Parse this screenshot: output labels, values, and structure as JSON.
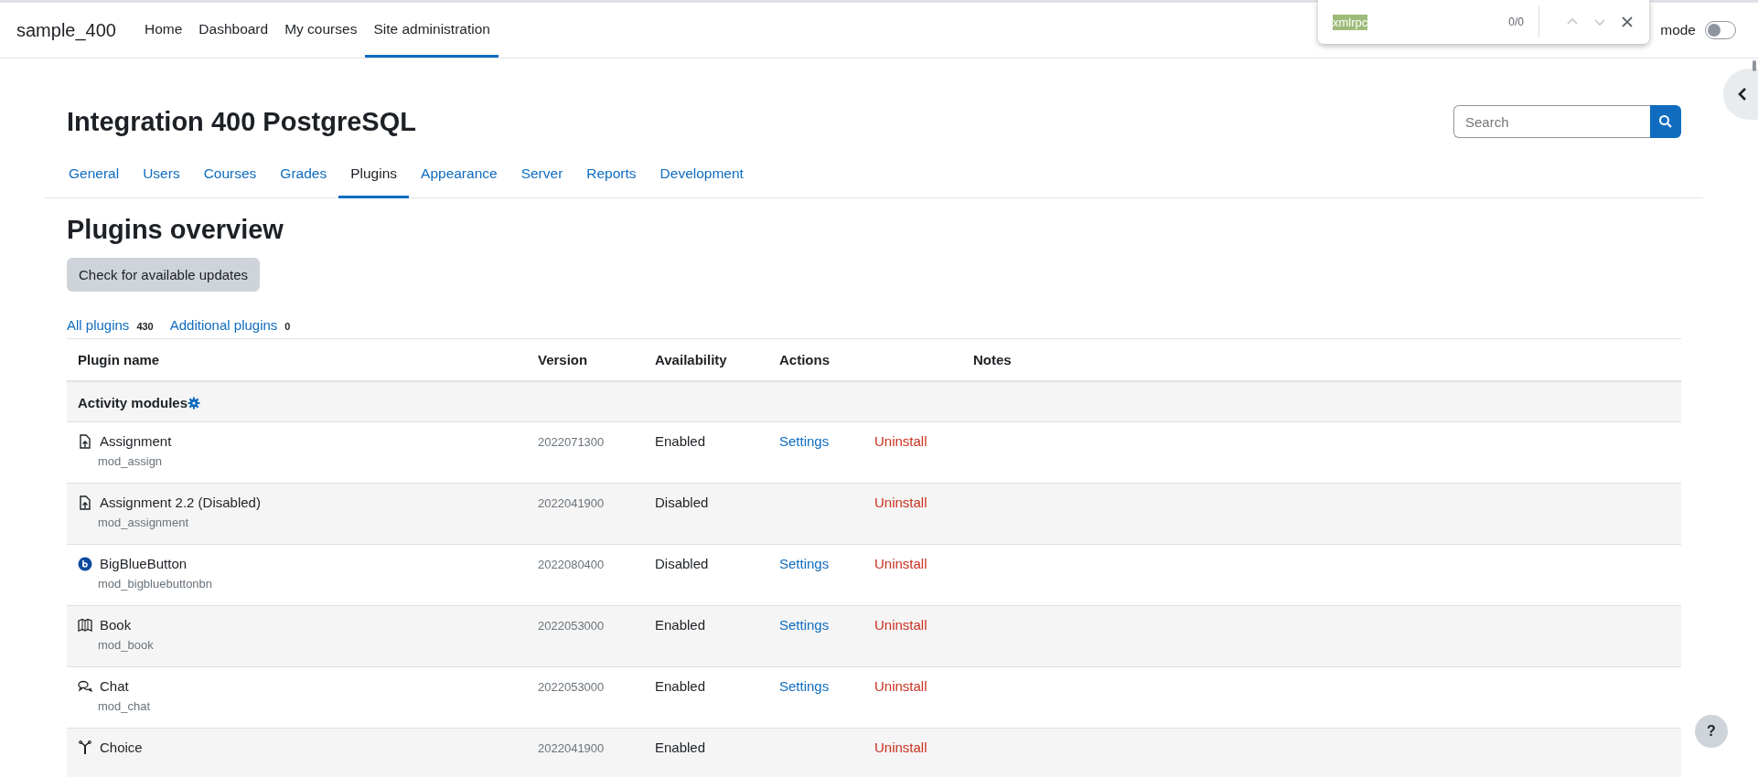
{
  "navbar": {
    "brand": "sample_400",
    "items": [
      {
        "label": "Home",
        "selected": false
      },
      {
        "label": "Dashboard",
        "selected": false
      },
      {
        "label": "My courses",
        "selected": false
      },
      {
        "label": "Site administration",
        "selected": true
      }
    ],
    "edit_mode": {
      "label": "mode",
      "on": false
    }
  },
  "find_bar": {
    "query": "xmlrpc",
    "count": "0/0"
  },
  "header": {
    "title": "Integration 400 PostgreSQL",
    "search": {
      "placeholder": "Search"
    }
  },
  "tabs": [
    {
      "label": "General",
      "selected": false
    },
    {
      "label": "Users",
      "selected": false
    },
    {
      "label": "Courses",
      "selected": false
    },
    {
      "label": "Grades",
      "selected": false
    },
    {
      "label": "Plugins",
      "selected": true
    },
    {
      "label": "Appearance",
      "selected": false
    },
    {
      "label": "Server",
      "selected": false
    },
    {
      "label": "Reports",
      "selected": false
    },
    {
      "label": "Development",
      "selected": false
    }
  ],
  "page_title": "Plugins overview",
  "update_button": "Check for available updates",
  "filters": [
    {
      "label": "All plugins",
      "count": "430"
    },
    {
      "label": "Additional plugins",
      "count": "0"
    }
  ],
  "table": {
    "columns": [
      "Plugin name",
      "Version",
      "Availability",
      "Actions",
      "Notes"
    ],
    "group": "Activity modules",
    "rows": [
      {
        "kind": "assign",
        "name": "Assignment",
        "component": "mod_assign",
        "version": "2022071300",
        "availability": "Enabled",
        "settings": "Settings",
        "uninstall": "Uninstall"
      },
      {
        "kind": "assign",
        "name": "Assignment 2.2 (Disabled)",
        "component": "mod_assignment",
        "version": "2022041900",
        "availability": "Disabled",
        "uninstall": "Uninstall"
      },
      {
        "kind": "bigbluebutton",
        "name": "BigBlueButton",
        "component": "mod_bigbluebuttonbn",
        "version": "2022080400",
        "availability": "Disabled",
        "settings": "Settings",
        "uninstall": "Uninstall"
      },
      {
        "kind": "book",
        "name": "Book",
        "component": "mod_book",
        "version": "2022053000",
        "availability": "Enabled",
        "settings": "Settings",
        "uninstall": "Uninstall"
      },
      {
        "kind": "chat",
        "name": "Chat",
        "component": "mod_chat",
        "version": "2022053000",
        "availability": "Enabled",
        "settings": "Settings",
        "uninstall": "Uninstall"
      },
      {
        "kind": "choice",
        "name": "Choice",
        "version": "2022041900",
        "availability": "Enabled",
        "uninstall": "Uninstall"
      }
    ]
  },
  "help_button": "?"
}
